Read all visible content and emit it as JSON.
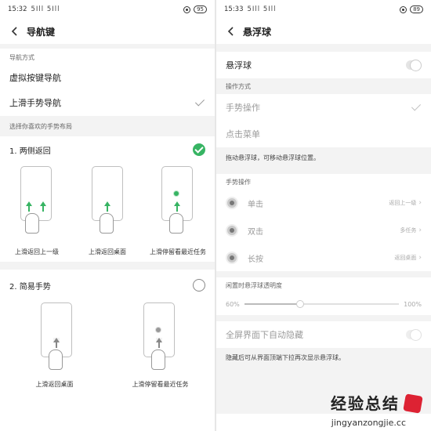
{
  "left": {
    "status_time": "15:32",
    "status_signal": "5Ill 5Ill",
    "status_battery": "95",
    "title": "导航键",
    "section_nav_mode": "导航方式",
    "nav_options": [
      {
        "label": "虚拟按键导航",
        "checked": false
      },
      {
        "label": "上滑手势导航",
        "checked": true
      }
    ],
    "section_layout": "选择你喜欢的手势布局",
    "gesture_groups": [
      {
        "title": "1. 两侧返回",
        "selected": true,
        "captions": [
          "上滑返回上一级",
          "上滑返回桌面",
          "上滑停留看最近任务"
        ]
      },
      {
        "title": "2. 简易手势",
        "selected": false,
        "captions": [
          "上滑返回桌面",
          "上滑停留看最近任务"
        ]
      }
    ],
    "accent": "#37b463"
  },
  "right": {
    "status_time": "15:33",
    "status_signal": "5Ill 5Ill",
    "status_battery": "89",
    "title": "悬浮球",
    "toggle_label": "悬浮球",
    "toggle_on": false,
    "section_op_mode": "操作方式",
    "op_modes": [
      {
        "label": "手势操作",
        "checked": true
      },
      {
        "label": "点击菜单",
        "checked": false
      }
    ],
    "hint_drag": "拖动悬浮球，可移动悬浮球位置。",
    "section_gestures": "手势操作",
    "gestures": [
      {
        "name": "单击",
        "value": "返回上一级"
      },
      {
        "name": "双击",
        "value": "多任务"
      },
      {
        "name": "长按",
        "value": "返回桌面"
      }
    ],
    "section_opacity": "闲置时悬浮球透明度",
    "opacity_min": "60%",
    "opacity_max": "100%",
    "opacity_level": 0.36,
    "fullscreen_label": "全屏界面下自动隐藏",
    "fullscreen_on": false,
    "hint_fullscreen": "隐藏后可从界面顶端下拉再次显示悬浮球。"
  },
  "watermark": {
    "text_cn": "经验总结",
    "url": "jingyanzongjie.cc"
  }
}
